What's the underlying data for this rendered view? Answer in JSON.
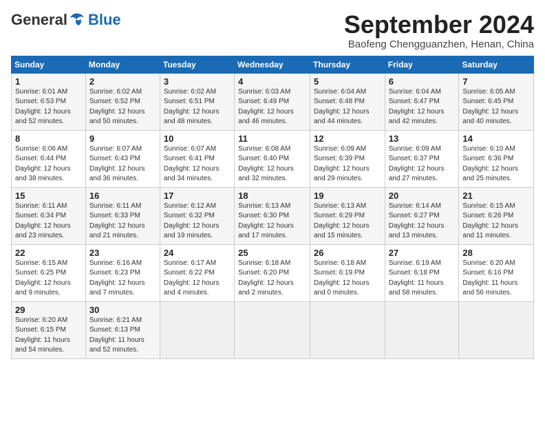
{
  "header": {
    "logo_general": "General",
    "logo_blue": "Blue",
    "month_title": "September 2024",
    "subtitle": "Baofeng Chengguanzhen, Henan, China"
  },
  "weekdays": [
    "Sunday",
    "Monday",
    "Tuesday",
    "Wednesday",
    "Thursday",
    "Friday",
    "Saturday"
  ],
  "weeks": [
    [
      {
        "day": "1",
        "info": "Sunrise: 6:01 AM\nSunset: 6:53 PM\nDaylight: 12 hours\nand 52 minutes."
      },
      {
        "day": "2",
        "info": "Sunrise: 6:02 AM\nSunset: 6:52 PM\nDaylight: 12 hours\nand 50 minutes."
      },
      {
        "day": "3",
        "info": "Sunrise: 6:02 AM\nSunset: 6:51 PM\nDaylight: 12 hours\nand 48 minutes."
      },
      {
        "day": "4",
        "info": "Sunrise: 6:03 AM\nSunset: 6:49 PM\nDaylight: 12 hours\nand 46 minutes."
      },
      {
        "day": "5",
        "info": "Sunrise: 6:04 AM\nSunset: 6:48 PM\nDaylight: 12 hours\nand 44 minutes."
      },
      {
        "day": "6",
        "info": "Sunrise: 6:04 AM\nSunset: 6:47 PM\nDaylight: 12 hours\nand 42 minutes."
      },
      {
        "day": "7",
        "info": "Sunrise: 6:05 AM\nSunset: 6:45 PM\nDaylight: 12 hours\nand 40 minutes."
      }
    ],
    [
      {
        "day": "8",
        "info": "Sunrise: 6:06 AM\nSunset: 6:44 PM\nDaylight: 12 hours\nand 38 minutes."
      },
      {
        "day": "9",
        "info": "Sunrise: 6:07 AM\nSunset: 6:43 PM\nDaylight: 12 hours\nand 36 minutes."
      },
      {
        "day": "10",
        "info": "Sunrise: 6:07 AM\nSunset: 6:41 PM\nDaylight: 12 hours\nand 34 minutes."
      },
      {
        "day": "11",
        "info": "Sunrise: 6:08 AM\nSunset: 6:40 PM\nDaylight: 12 hours\nand 32 minutes."
      },
      {
        "day": "12",
        "info": "Sunrise: 6:09 AM\nSunset: 6:39 PM\nDaylight: 12 hours\nand 29 minutes."
      },
      {
        "day": "13",
        "info": "Sunrise: 6:09 AM\nSunset: 6:37 PM\nDaylight: 12 hours\nand 27 minutes."
      },
      {
        "day": "14",
        "info": "Sunrise: 6:10 AM\nSunset: 6:36 PM\nDaylight: 12 hours\nand 25 minutes."
      }
    ],
    [
      {
        "day": "15",
        "info": "Sunrise: 6:11 AM\nSunset: 6:34 PM\nDaylight: 12 hours\nand 23 minutes."
      },
      {
        "day": "16",
        "info": "Sunrise: 6:11 AM\nSunset: 6:33 PM\nDaylight: 12 hours\nand 21 minutes."
      },
      {
        "day": "17",
        "info": "Sunrise: 6:12 AM\nSunset: 6:32 PM\nDaylight: 12 hours\nand 19 minutes."
      },
      {
        "day": "18",
        "info": "Sunrise: 6:13 AM\nSunset: 6:30 PM\nDaylight: 12 hours\nand 17 minutes."
      },
      {
        "day": "19",
        "info": "Sunrise: 6:13 AM\nSunset: 6:29 PM\nDaylight: 12 hours\nand 15 minutes."
      },
      {
        "day": "20",
        "info": "Sunrise: 6:14 AM\nSunset: 6:27 PM\nDaylight: 12 hours\nand 13 minutes."
      },
      {
        "day": "21",
        "info": "Sunrise: 6:15 AM\nSunset: 6:26 PM\nDaylight: 12 hours\nand 11 minutes."
      }
    ],
    [
      {
        "day": "22",
        "info": "Sunrise: 6:15 AM\nSunset: 6:25 PM\nDaylight: 12 hours\nand 9 minutes."
      },
      {
        "day": "23",
        "info": "Sunrise: 6:16 AM\nSunset: 6:23 PM\nDaylight: 12 hours\nand 7 minutes."
      },
      {
        "day": "24",
        "info": "Sunrise: 6:17 AM\nSunset: 6:22 PM\nDaylight: 12 hours\nand 4 minutes."
      },
      {
        "day": "25",
        "info": "Sunrise: 6:18 AM\nSunset: 6:20 PM\nDaylight: 12 hours\nand 2 minutes."
      },
      {
        "day": "26",
        "info": "Sunrise: 6:18 AM\nSunset: 6:19 PM\nDaylight: 12 hours\nand 0 minutes."
      },
      {
        "day": "27",
        "info": "Sunrise: 6:19 AM\nSunset: 6:18 PM\nDaylight: 11 hours\nand 58 minutes."
      },
      {
        "day": "28",
        "info": "Sunrise: 6:20 AM\nSunset: 6:16 PM\nDaylight: 11 hours\nand 56 minutes."
      }
    ],
    [
      {
        "day": "29",
        "info": "Sunrise: 6:20 AM\nSunset: 6:15 PM\nDaylight: 11 hours\nand 54 minutes."
      },
      {
        "day": "30",
        "info": "Sunrise: 6:21 AM\nSunset: 6:13 PM\nDaylight: 11 hours\nand 52 minutes."
      },
      {
        "day": "",
        "info": ""
      },
      {
        "day": "",
        "info": ""
      },
      {
        "day": "",
        "info": ""
      },
      {
        "day": "",
        "info": ""
      },
      {
        "day": "",
        "info": ""
      }
    ]
  ]
}
